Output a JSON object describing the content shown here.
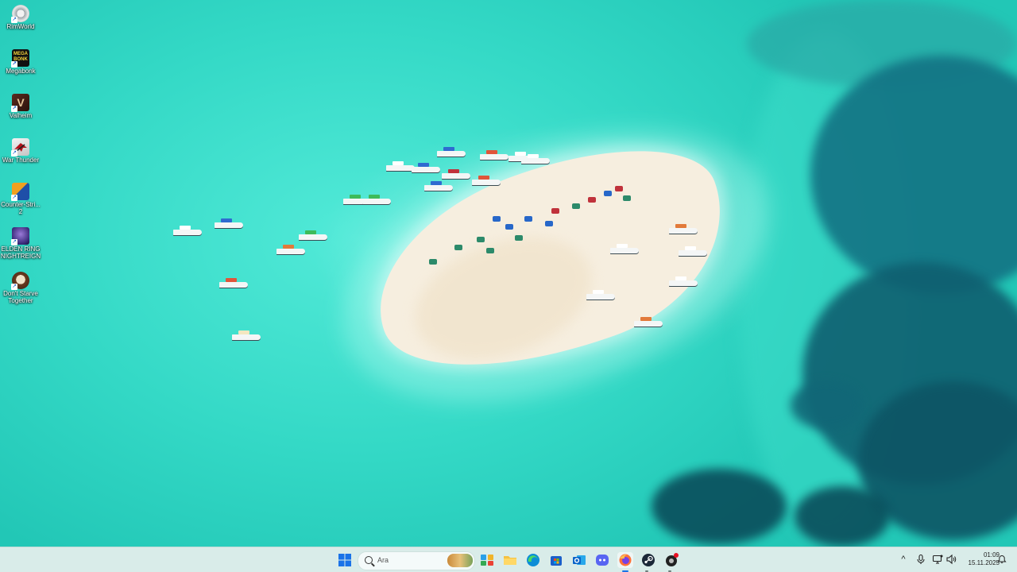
{
  "desktop": {
    "icons": [
      {
        "label": "RimWorld",
        "icon": "rimworld-icon"
      },
      {
        "label": "Megabonk",
        "icon": "megabonk-icon"
      },
      {
        "label": "Valheim",
        "icon": "valheim-icon"
      },
      {
        "label": "War Thunder",
        "icon": "war-thunder-icon"
      },
      {
        "label": "Counter-Stri... 2",
        "icon": "counter-strike-icon"
      },
      {
        "label": "ELDEN RING NIGHTREIGN",
        "icon": "elden-ring-icon"
      },
      {
        "label": "Don't Starve Together",
        "icon": "dont-starve-icon"
      }
    ],
    "megabonk_logo_text": "MEGA BONK"
  },
  "taskbar": {
    "search_placeholder": "Ara",
    "apps": [
      "start-icon",
      "widgets-icon",
      "file-explorer-icon",
      "edge-icon",
      "store-icon",
      "outlook-icon",
      "discord-icon",
      "firefox-icon",
      "steam-icon",
      "game-app-icon"
    ],
    "tray": {
      "chevron": "^",
      "icons": [
        "microphone-icon",
        "network-icon",
        "volume-icon"
      ]
    },
    "clock": {
      "time": "01:09",
      "date": "15.11.2025"
    }
  },
  "colors": {
    "taskbar_bg": "#d9ece9",
    "water": "#34d9c6",
    "deep_water": "#0f5f70",
    "sand": "#f6eedf"
  }
}
